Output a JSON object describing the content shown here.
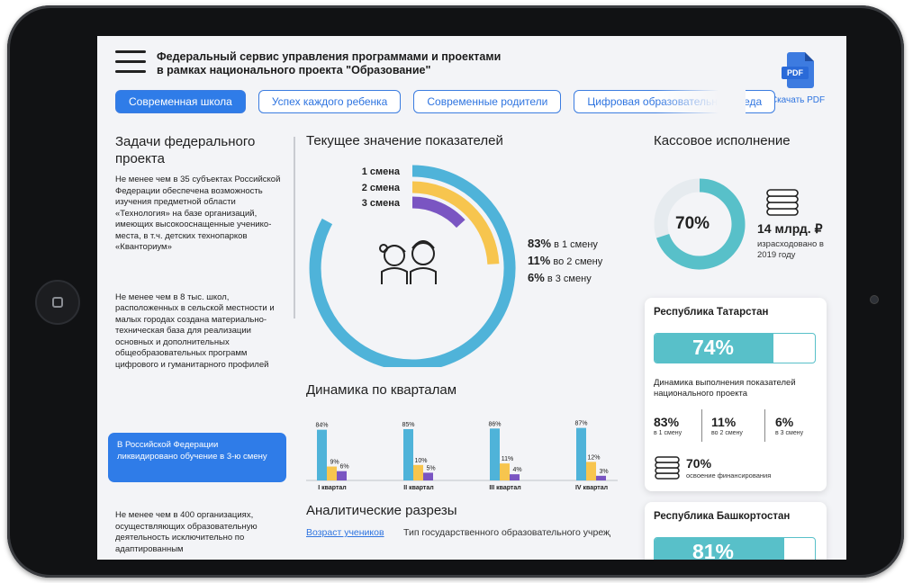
{
  "header": {
    "title_line1": "Федеральный сервис управления программами и проектами",
    "title_line2": "в рамках национального проекта \"Образование\"",
    "pdf_badge": "PDF",
    "pdf_label": "Скачать PDF"
  },
  "tabs": [
    {
      "label": "Современная школа",
      "active": true
    },
    {
      "label": "Успех каждого ребенка",
      "active": false
    },
    {
      "label": "Современные родители",
      "active": false
    },
    {
      "label": "Цифровая образовательная среда",
      "active": false
    }
  ],
  "left": {
    "heading": "Задачи федерального проекта",
    "task1": "Не менее чем в 35 субъектах Российской Федерации обеспечена возможность изучения предметной области «Технология» на базе организаций, имеющих высокооснащенные ученико-места, в т.ч. детских технопарков «Кванториум»",
    "task2": "Не менее чем в 8 тыс. школ, расположенных в сельской местности и малых городах создана материально-техническая база для реализации основных и дополнительных общеобразовательных программ цифрового и гуманитарного профилей",
    "note": "В Российской Федерации ликвидировано обучение в 3-ю смену",
    "task3": "Не менее чем в 400 организациях, осуществляющих образовательную деятельность исключительно по адаптированным"
  },
  "indicators": {
    "title": "Текущее значение показателей",
    "rings": [
      {
        "label": "1 смена",
        "value": 83,
        "color": "#4fb3d9"
      },
      {
        "label": "2 смена",
        "value": 11,
        "color": "#f7c54e"
      },
      {
        "label": "3 смена",
        "value": 6,
        "color": "#7a55c2"
      }
    ],
    "legend": [
      {
        "pct": "83%",
        "text": "в 1 смену"
      },
      {
        "pct": "11%",
        "text": "во 2 смену"
      },
      {
        "pct": "6%",
        "text": "в 3 смену"
      }
    ]
  },
  "quarters": {
    "title": "Динамика по кварталам",
    "chart_data": {
      "type": "bar",
      "categories": [
        "I квартал",
        "II квартал",
        "III квартал",
        "IV квартал"
      ],
      "series": [
        {
          "name": "1 смена",
          "values": [
            84,
            85,
            86,
            87
          ],
          "color": "#4fb3d9"
        },
        {
          "name": "2 смена",
          "values": [
            9,
            10,
            11,
            12
          ],
          "color": "#f7c54e"
        },
        {
          "name": "3 смена",
          "values": [
            6,
            5,
            4,
            3
          ],
          "color": "#7a55c2"
        }
      ],
      "value_labels": [
        [
          "84%",
          "9%",
          "6%"
        ],
        [
          "85%",
          "10%",
          "5%"
        ],
        [
          "86%",
          "11%",
          "4%"
        ],
        [
          "87%",
          "12%",
          "3%"
        ]
      ],
      "ylim": [
        0,
        100
      ]
    }
  },
  "analytics": {
    "title": "Аналитические разрезы",
    "link": "Возраст учеников",
    "text": "Тип государственного образовательного учреждения"
  },
  "cash": {
    "title": "Кассовое исполнение",
    "percent_value": 70,
    "percent_text": "70%",
    "amount": "14 млрд. ₽",
    "note": "израсходовано в 2019 году",
    "color": "#58c0c9"
  },
  "regions": [
    {
      "name": "Республика Татарстан",
      "progress_value": 74,
      "progress_text": "74%",
      "desc": "Динамика выполнения показателей национального проекта",
      "stats": [
        {
          "v": "83%",
          "l": "в 1 смену"
        },
        {
          "v": "11%",
          "l": "во 2 смену"
        },
        {
          "v": "6%",
          "l": "в 3 смену"
        }
      ],
      "finance_value": "70%",
      "finance_label": "освоение финансирования"
    },
    {
      "name": "Республика Башкортостан",
      "progress_value": 81,
      "progress_text": "81%"
    }
  ]
}
